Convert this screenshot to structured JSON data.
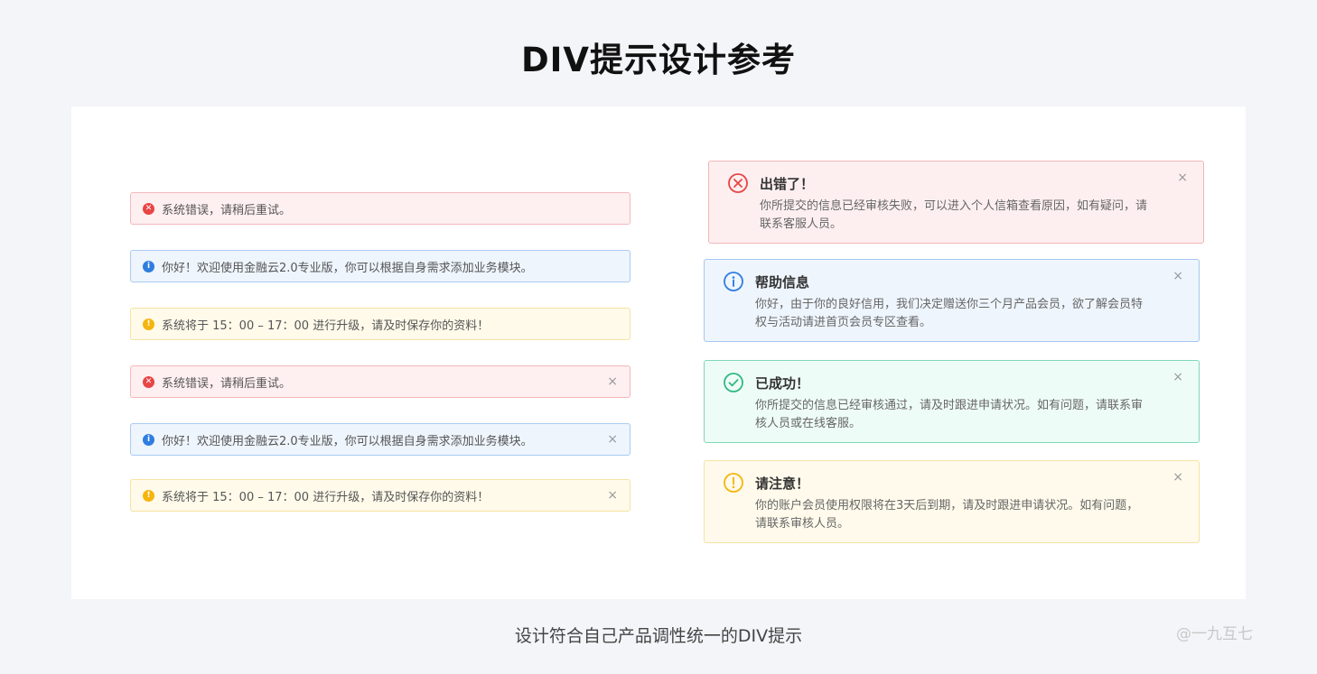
{
  "header": {
    "title": "DIV提示设计参考"
  },
  "simple_alerts": [
    {
      "type": "error",
      "text": "系统错误，请稍后重试。",
      "closable": false
    },
    {
      "type": "info",
      "text": "你好！欢迎使用金融云2.0专业版，你可以根据自身需求添加业务模块。",
      "closable": false
    },
    {
      "type": "warning",
      "text": "系统将于 15：00 – 17：00 进行升级，请及时保存你的资料！",
      "closable": false
    },
    {
      "type": "error",
      "text": "系统错误，请稍后重试。",
      "closable": true
    },
    {
      "type": "info",
      "text": "你好！欢迎使用金融云2.0专业版，你可以根据自身需求添加业务模块。",
      "closable": true
    },
    {
      "type": "warning",
      "text": "系统将于 15：00 – 17：00 进行升级，请及时保存你的资料！",
      "closable": true
    }
  ],
  "detail_alerts": [
    {
      "type": "error",
      "title": "出错了！",
      "body": "你所提交的信息已经审核失败，可以进入个人信箱查看原因，如有疑问，请联系客服人员。"
    },
    {
      "type": "info",
      "title": "帮助信息",
      "body": "你好，由于你的良好信用，我们决定赠送你三个月产品会员，欲了解会员特权与活动请进首页会员专区查看。"
    },
    {
      "type": "success",
      "title": "已成功！",
      "body": "你所提交的信息已经审核通过，请及时跟进申请状况。如有问题，请联系审核人员或在线客服。"
    },
    {
      "type": "warning",
      "title": "请注意！",
      "body": "你的账户会员使用权限将在3天后到期，请及时跟进申请状况。如有问题，请联系审核人员。"
    }
  ],
  "icons": {
    "close": "×",
    "error": "x-circle-icon",
    "info": "info-circle-icon",
    "success": "check-circle-icon",
    "warning": "exclamation-circle-icon"
  },
  "colors": {
    "error": "#e84545",
    "info": "#2f7ddf",
    "success": "#30b982",
    "warning": "#f5b50e"
  },
  "footer": {
    "caption": "设计符合自己产品调性统一的DIV提示",
    "watermark": "@一九互七"
  }
}
